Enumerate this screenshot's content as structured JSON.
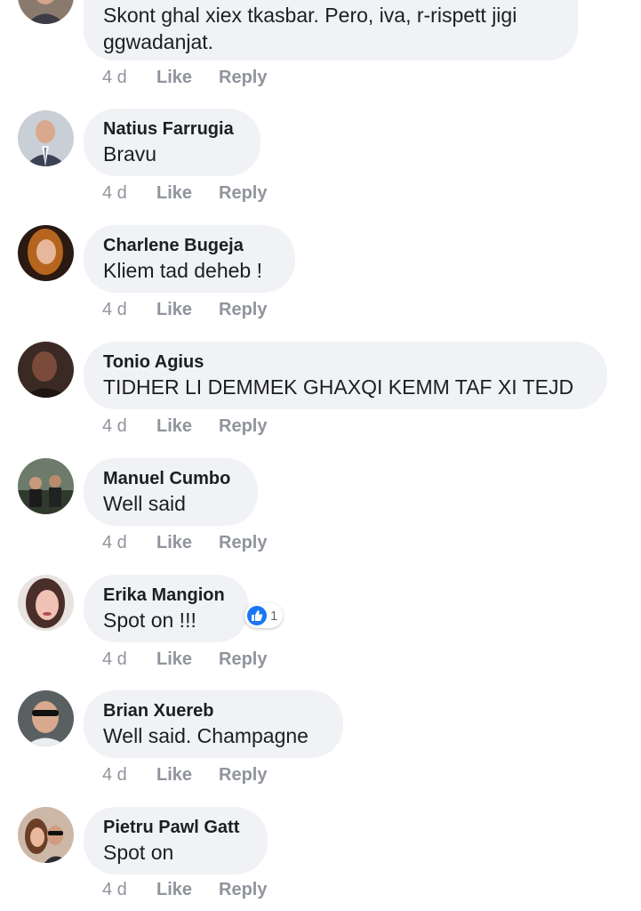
{
  "comments": [
    {
      "author": "",
      "text_lines": [
        "Skont ghal xiex tkasbar. Pero, iva, r-rispett jigi",
        "ggwadanjat."
      ],
      "time": "4 d",
      "like_label": "Like",
      "reply_label": "Reply"
    },
    {
      "author": "Natius Farrugia",
      "text": "Bravu",
      "time": "4 d",
      "like_label": "Like",
      "reply_label": "Reply"
    },
    {
      "author": "Charlene Bugeja",
      "text": "Kliem tad deheb !",
      "time": "4 d",
      "like_label": "Like",
      "reply_label": "Reply"
    },
    {
      "author": "Tonio Agius",
      "text": "TIDHER LI DEMMEK GHAXQI KEMM TAF XI TEJD",
      "time": "4 d",
      "like_label": "Like",
      "reply_label": "Reply"
    },
    {
      "author": "Manuel Cumbo",
      "text": "Well said",
      "time": "4 d",
      "like_label": "Like",
      "reply_label": "Reply"
    },
    {
      "author": "Erika Mangion",
      "text": "Spot on !!!",
      "reaction_count": "1",
      "reaction_icon": "thumbs-up-icon",
      "time": "4 d",
      "like_label": "Like",
      "reply_label": "Reply"
    },
    {
      "author": "Brian Xuereb",
      "text": "Well said. Champagne",
      "time": "4 d",
      "like_label": "Like",
      "reply_label": "Reply"
    },
    {
      "author": "Pietru Pawl Gatt",
      "text": "Spot on",
      "time": "4 d",
      "like_label": "Like",
      "reply_label": "Reply"
    }
  ],
  "colors": {
    "bubble": "#f1f2f6",
    "text": "#1c1e21",
    "meta": "#90949c",
    "reaction": "#1877f2"
  }
}
